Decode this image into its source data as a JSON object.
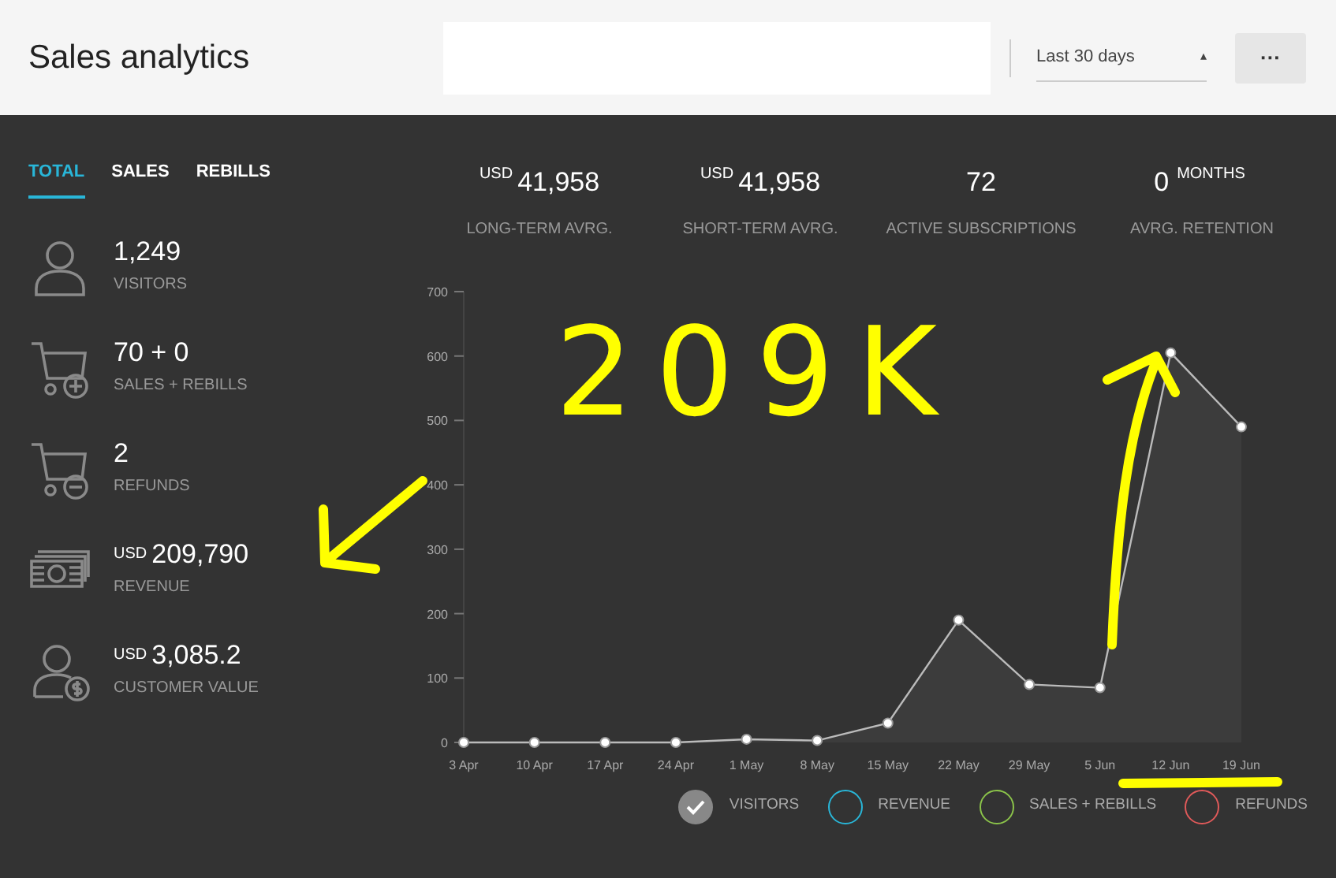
{
  "header": {
    "title": "Sales analytics",
    "period": "Last 30 days",
    "period_caret": "▴",
    "more_button": "···"
  },
  "tabs": [
    {
      "label": "TOTAL",
      "selected": true
    },
    {
      "label": "SALES",
      "selected": false
    },
    {
      "label": "REBILLS",
      "selected": false
    }
  ],
  "summary": [
    {
      "unit": "USD",
      "value": "41,958",
      "label": "LONG-TERM AVRG."
    },
    {
      "unit": "USD",
      "value": "41,958",
      "label": "SHORT-TERM AVRG."
    },
    {
      "value": "72",
      "label": "ACTIVE SUBSCRIPTIONS"
    },
    {
      "value": "0",
      "suffix": "MONTHS",
      "label": "AVRG. RETENTION"
    }
  ],
  "metrics": [
    {
      "kind": "person",
      "value": "1,249",
      "label": "VISITORS"
    },
    {
      "kind": "cart-plus",
      "value": "70 + 0",
      "label": "SALES + REBILLS"
    },
    {
      "kind": "cart-minus",
      "value": "2",
      "label": "REFUNDS"
    },
    {
      "kind": "money",
      "unit": "USD",
      "value": "209,790",
      "label": "REVENUE"
    },
    {
      "kind": "person-dollar",
      "unit": "USD",
      "value": "3,085.2",
      "label": "CUSTOMER VALUE"
    }
  ],
  "chart_data": {
    "type": "area",
    "categories": [
      "3 Apr",
      "10 Apr",
      "17 Apr",
      "24 Apr",
      "1 May",
      "8 May",
      "15 May",
      "22 May",
      "29 May",
      "5 Jun",
      "12 Jun",
      "19 Jun"
    ],
    "series": [
      {
        "color": "#bbbbbb",
        "values": [
          0,
          0,
          0,
          0,
          5,
          3,
          30,
          190,
          90,
          85,
          605,
          490
        ]
      }
    ],
    "ylim": [
      0,
      700
    ],
    "yticks": [
      0,
      100,
      200,
      300,
      400,
      500,
      600,
      700
    ]
  },
  "legend": [
    {
      "label": "VISITORS",
      "color": "#888888",
      "selected": true
    },
    {
      "label": "REVENUE",
      "color": "#29b6d8",
      "selected": false
    },
    {
      "label": "SALES + REBILLS",
      "color": "#8bc34a",
      "selected": false
    },
    {
      "label": "REFUNDS",
      "color": "#e05a5a",
      "selected": false
    }
  ],
  "annotations": [
    {
      "kind": "text",
      "text": "209K",
      "color": "#ffff00"
    },
    {
      "kind": "arrow-down-left",
      "color": "#ffff00"
    },
    {
      "kind": "arrow-up",
      "color": "#ffff00"
    },
    {
      "kind": "underline",
      "color": "#ffff00"
    }
  ]
}
